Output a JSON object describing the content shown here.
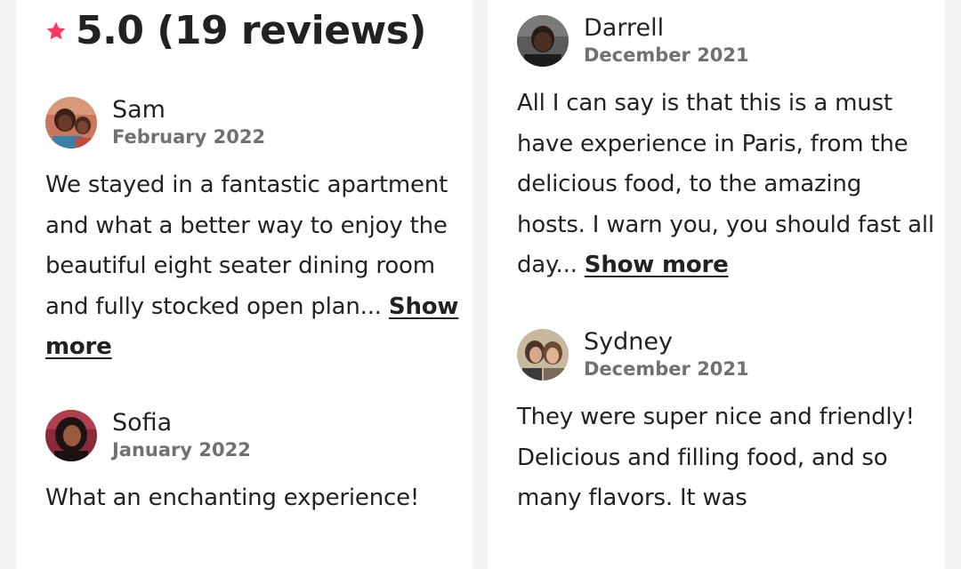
{
  "header": {
    "rating_text": "5.0 (19 reviews)",
    "star_icon": "star-icon",
    "star_color": "#FF385C"
  },
  "reviews_left": [
    {
      "name": "Sam",
      "date": "February 2022",
      "text": "We stayed in a fantastic apartment and what a better way to enjoy the beautiful eight seater dining room and fully stocked open plan...",
      "more": "Show more",
      "avatar_icon": "avatar-photo"
    },
    {
      "name": "Sofia",
      "date": "January 2022",
      "text": "What an enchanting experience!",
      "avatar_icon": "avatar-photo"
    }
  ],
  "reviews_right": [
    {
      "name": "Darrell",
      "date": "December 2021",
      "text": "All I can say is that this is a must have experience in Paris, from the delicious food, to the amazing hosts. I warn you, you should fast all day...",
      "more": "Show more",
      "avatar_icon": "avatar-photo"
    },
    {
      "name": "Sydney",
      "date": "December 2021",
      "text": "They were super nice and friendly! Delicious and filling food, and so many flavors. It was",
      "avatar_icon": "avatar-photo"
    }
  ],
  "colors": {
    "page_bg": "#F3F3F3",
    "card_bg": "#FFFFFF",
    "primary_text": "#222222",
    "secondary_text": "#717171"
  }
}
